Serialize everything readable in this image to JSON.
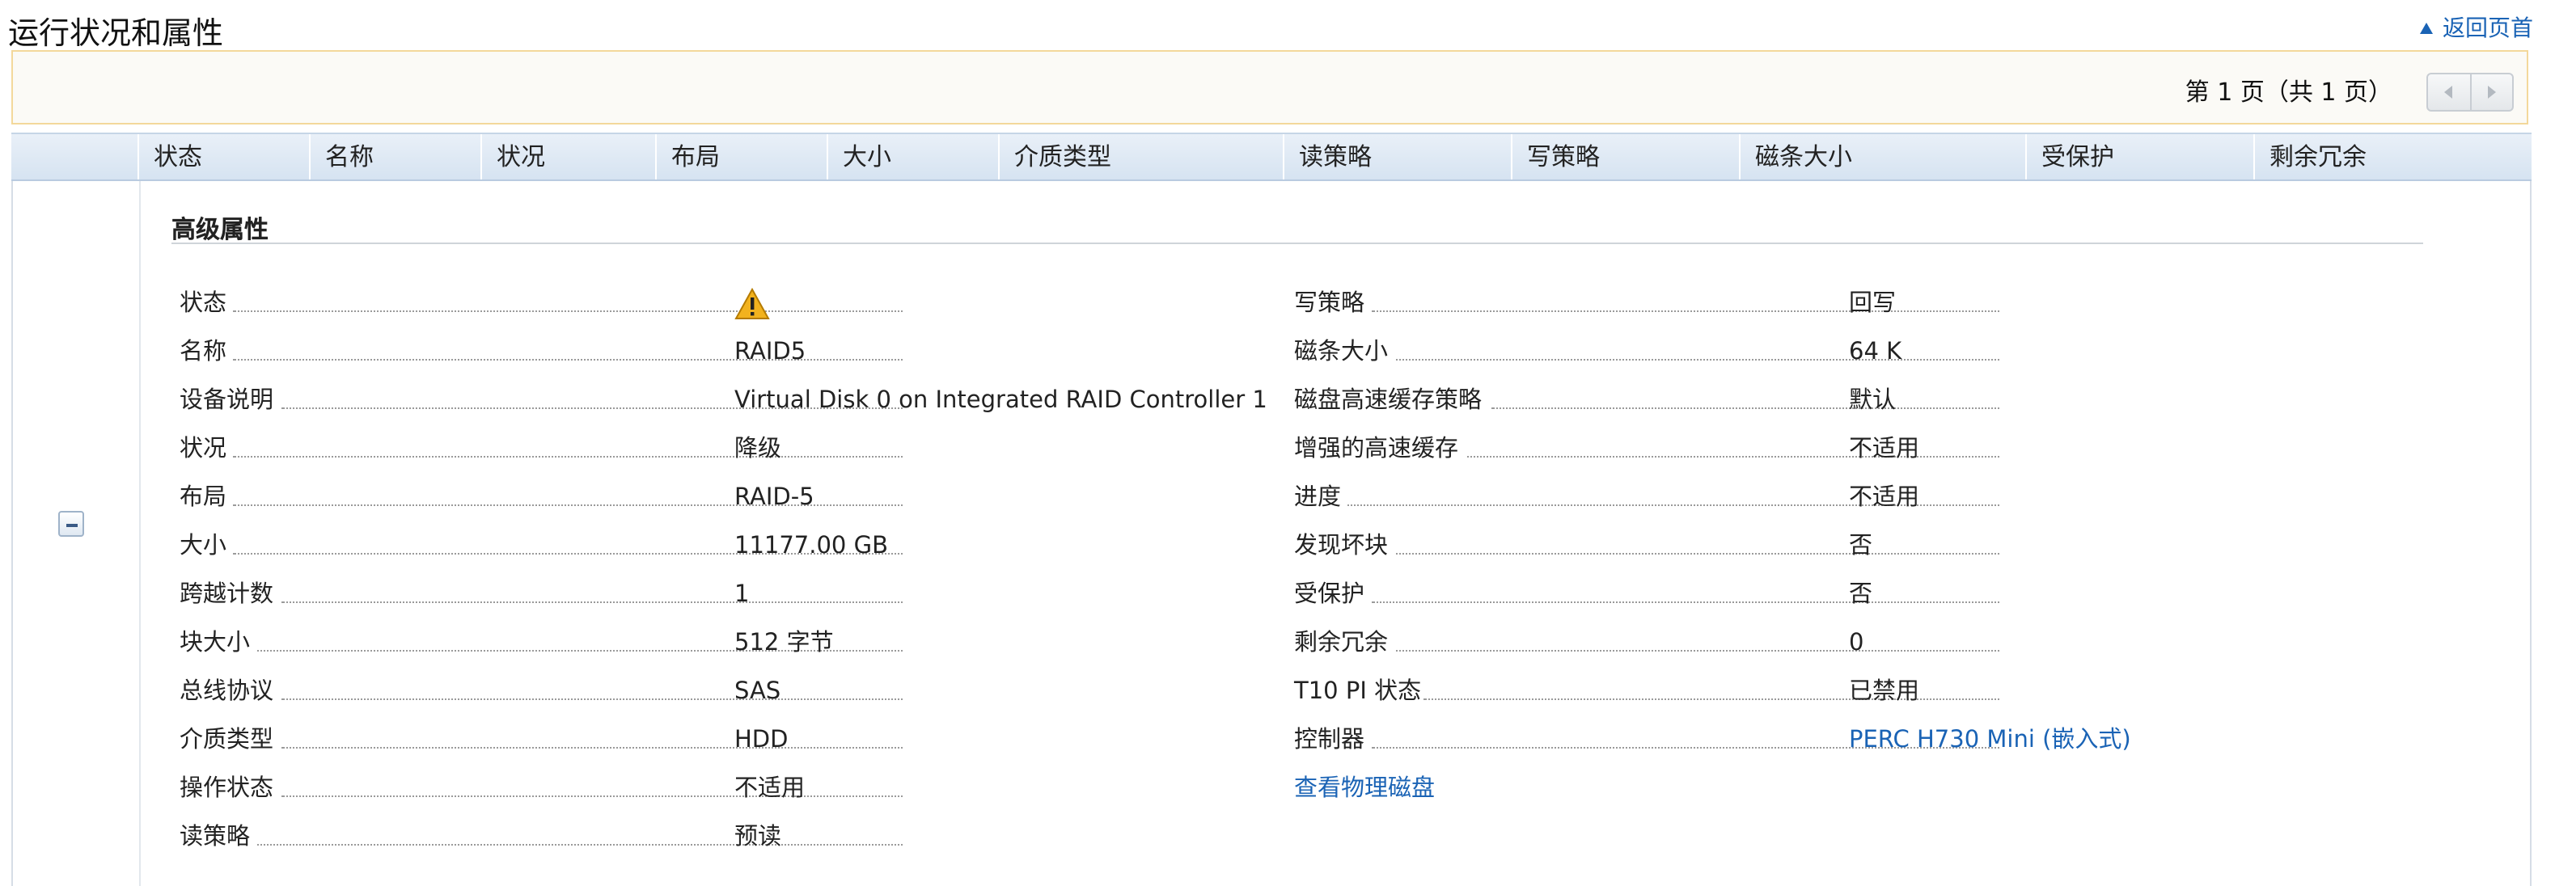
{
  "header": {
    "title": "运行状况和属性",
    "back_link": "返回页首"
  },
  "pager": {
    "text": "第 1 页（共 1 页）"
  },
  "table": {
    "columns": [
      "状态",
      "名称",
      "状况",
      "布局",
      "大小",
      "介质类型",
      "读策略",
      "写策略",
      "磁条大小",
      "受保护",
      "剩余冗余"
    ]
  },
  "details": {
    "section_title": "高级属性",
    "left": [
      {
        "label": "状态",
        "value": "",
        "icon": "warning-icon"
      },
      {
        "label": "名称",
        "value": "RAID5"
      },
      {
        "label": "设备说明",
        "value": "Virtual Disk 0 on Integrated RAID Controller 1"
      },
      {
        "label": "状况",
        "value": "降级"
      },
      {
        "label": "布局",
        "value": "RAID-5"
      },
      {
        "label": "大小",
        "value": "11177.00 GB"
      },
      {
        "label": "跨越计数",
        "value": "1"
      },
      {
        "label": "块大小",
        "value": "512 字节"
      },
      {
        "label": "总线协议",
        "value": "SAS"
      },
      {
        "label": "介质类型",
        "value": "HDD"
      },
      {
        "label": "操作状态",
        "value": "不适用"
      },
      {
        "label": "读策略",
        "value": "预读"
      }
    ],
    "right": [
      {
        "label": "写策略",
        "value": "回写"
      },
      {
        "label": "磁条大小",
        "value": "64 K"
      },
      {
        "label": "磁盘高速缓存策略",
        "value": "默认"
      },
      {
        "label": "增强的高速缓存",
        "value": "不适用"
      },
      {
        "label": "进度",
        "value": "不适用"
      },
      {
        "label": "发现坏块",
        "value": "否"
      },
      {
        "label": "受保护",
        "value": "否"
      },
      {
        "label": "剩余冗余",
        "value": "0"
      },
      {
        "label": "T10 PI 状态",
        "value": "已禁用"
      },
      {
        "label": "控制器",
        "value": "PERC H730 Mini (嵌入式)",
        "link": true
      }
    ],
    "view_disks_link": "查看物理磁盘"
  },
  "colors": {
    "link": "#1a63b5",
    "warning": "#f2b21e",
    "header_bg": "#d6e3f1",
    "pager_border": "#f3d89b"
  }
}
